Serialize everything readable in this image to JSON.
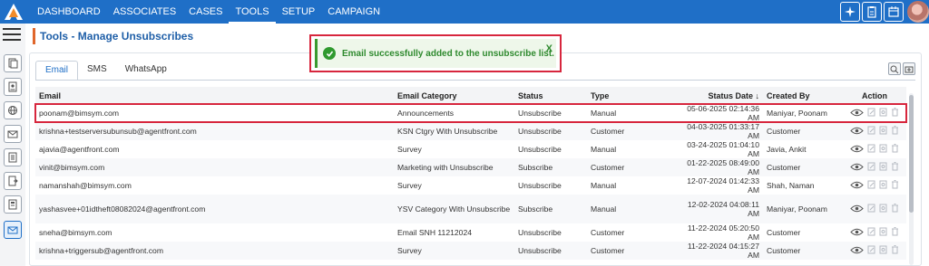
{
  "nav": {
    "items": [
      {
        "label": "DASHBOARD",
        "active": false
      },
      {
        "label": "ASSOCIATES",
        "active": false
      },
      {
        "label": "CASES",
        "active": false
      },
      {
        "label": "TOOLS",
        "active": true
      },
      {
        "label": "SETUP",
        "active": false
      },
      {
        "label": "CAMPAIGN",
        "active": false
      }
    ],
    "icons": [
      "sparkle-icon",
      "clipboard-icon",
      "calendar-icon",
      "user-avatar"
    ],
    "accent": "#1f6fc7"
  },
  "page": {
    "title": "Tools - Manage Unsubscribes",
    "title_accent": "#e0662b"
  },
  "toast": {
    "message": "Email successfully added to the unsubscribe list.",
    "close": "X",
    "color": "#2f8a2f"
  },
  "tabs": [
    {
      "label": "Email",
      "active": true
    },
    {
      "label": "SMS",
      "active": false
    },
    {
      "label": "WhatsApp",
      "active": false
    }
  ],
  "table": {
    "headers": {
      "email": "Email",
      "category": "Email Category",
      "status": "Status",
      "type": "Type",
      "date": "Status Date ↓",
      "by": "Created By",
      "action": "Action"
    },
    "rows": [
      {
        "email": "poonam@bimsym.com",
        "category": "Announcements",
        "status": "Unsubscribe",
        "type": "Manual",
        "date": "05-06-2025 02:14:36 AM",
        "by": "Maniyar, Poonam"
      },
      {
        "email": "krishna+testserversubunsub@agentfront.com",
        "category": "KSN Ctgry With Unsubscribe",
        "status": "Unsubscribe",
        "type": "Customer",
        "date": "04-03-2025 01:33:17 AM",
        "by": "Customer"
      },
      {
        "email": "ajavia@agentfront.com",
        "category": "Survey",
        "status": "Unsubscribe",
        "type": "Manual",
        "date": "03-24-2025 01:04:10 AM",
        "by": "Javia, Ankit"
      },
      {
        "email": "vinit@bimsym.com",
        "category": "Marketing with Unsubscribe",
        "status": "Subscribe",
        "type": "Customer",
        "date": "01-22-2025 08:49:00 AM",
        "by": "Customer"
      },
      {
        "email": "namanshah@bimsym.com",
        "category": "Survey",
        "status": "Unsubscribe",
        "type": "Manual",
        "date": "12-07-2024 01:42:33 AM",
        "by": "Shah, Naman"
      },
      {
        "email": "yashasvee+01idtheft08082024@agentfront.com",
        "category": "YSV Category With Unsubscribe",
        "status": "Subscribe",
        "type": "Manual",
        "date": "12-02-2024 04:08:11 AM",
        "by": "Maniyar, Poonam"
      },
      {
        "email": "sneha@bimsym.com",
        "category": "Email SNH 11212024",
        "status": "Unsubscribe",
        "type": "Customer",
        "date": "11-22-2024 05:20:50 AM",
        "by": "Customer"
      },
      {
        "email": "krishna+triggersub@agentfront.com",
        "category": "Survey",
        "status": "Unsubscribe",
        "type": "Customer",
        "date": "11-22-2024 04:15:27 AM",
        "by": "Customer"
      }
    ]
  }
}
